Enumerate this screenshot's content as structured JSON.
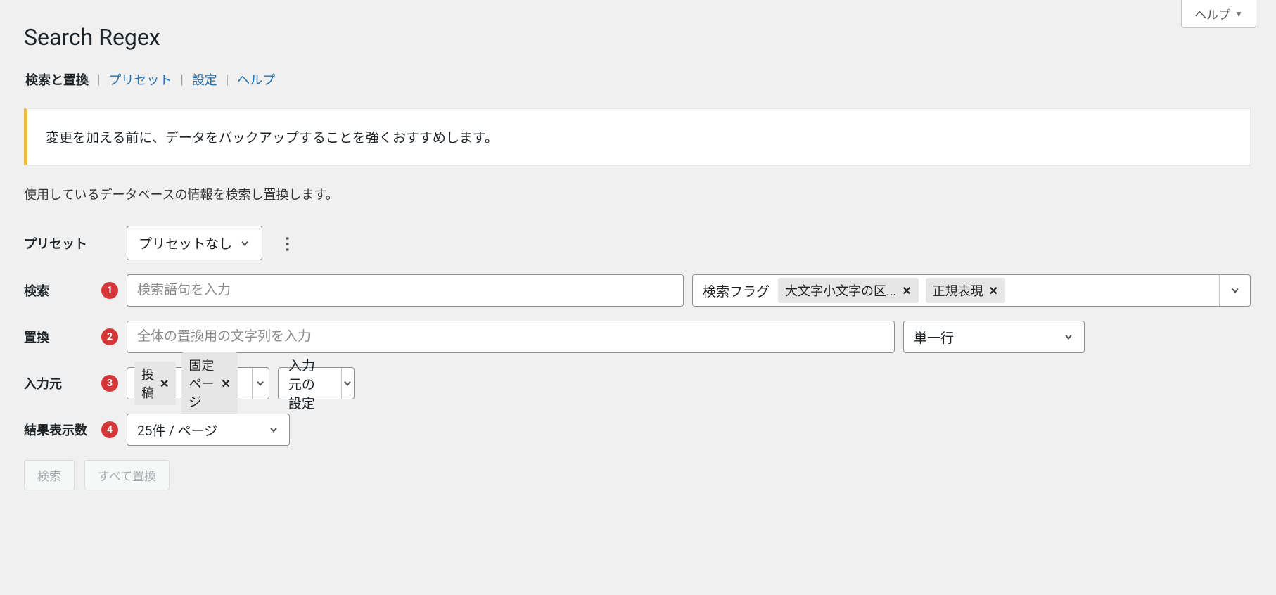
{
  "help_button": "ヘルプ",
  "page_title": "Search Regex",
  "tabs": {
    "search_replace": "検索と置換",
    "presets": "プリセット",
    "settings": "設定",
    "help": "ヘルプ"
  },
  "notice": "変更を加える前に、データをバックアップすることを強くおすすめします。",
  "description": "使用しているデータベースの情報を検索し置換します。",
  "annotations": {
    "search": "1",
    "replace": "2",
    "source": "3",
    "results": "4"
  },
  "form": {
    "preset": {
      "label": "プリセット",
      "value": "プリセットなし"
    },
    "search": {
      "label": "検索",
      "placeholder": "検索語句を入力",
      "flags_label": "検索フラグ",
      "flags": [
        {
          "label": "大文字小文字の区..."
        },
        {
          "label": "正規表現"
        }
      ]
    },
    "replace": {
      "label": "置換",
      "placeholder": "全体の置換用の文字列を入力",
      "mode": "単一行"
    },
    "source": {
      "label": "入力元",
      "items": [
        {
          "label": "投稿"
        },
        {
          "label": "固定ページ"
        }
      ],
      "options_label": "入力元の設定"
    },
    "results": {
      "label": "結果表示数",
      "value": "25件 / ページ"
    }
  },
  "buttons": {
    "search": "検索",
    "replace_all": "すべて置換"
  }
}
